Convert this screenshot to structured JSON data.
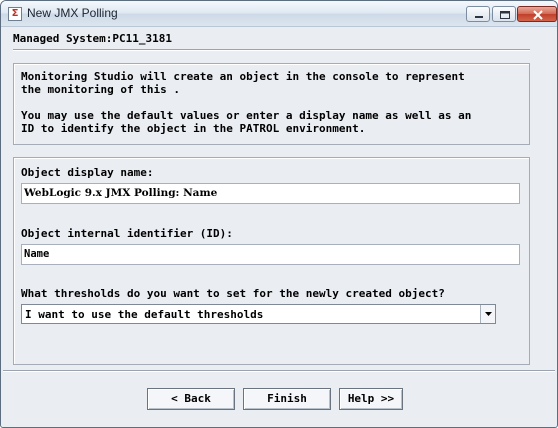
{
  "window": {
    "title": "New JMX Polling",
    "app_icon": "patrol-app-icon"
  },
  "header": {
    "managed_system": "Managed System:PC11_3181"
  },
  "info": {
    "paragraph1_line1": "Monitoring Studio will create an object in the console to represent",
    "paragraph1_line2": "the monitoring of this .",
    "paragraph2_line1": "You may use the default values or enter a display name as well as an",
    "paragraph2_line2": "ID to identify the object in the PATROL environment."
  },
  "form": {
    "display_name_label": "Object display name:",
    "display_name_value": "WebLogic 9.x JMX Polling: Name",
    "internal_id_label": "Object internal identifier (ID):",
    "internal_id_value": "Name",
    "thresholds_label": "What thresholds do you want to set for the newly created object?",
    "thresholds_selected": "I want to use the default thresholds"
  },
  "buttons": {
    "back": "< Back",
    "finish": "Finish",
    "help": "Help >>"
  },
  "colors": {
    "window_bg": "#eaeef3",
    "close_button": "#c0402a"
  }
}
